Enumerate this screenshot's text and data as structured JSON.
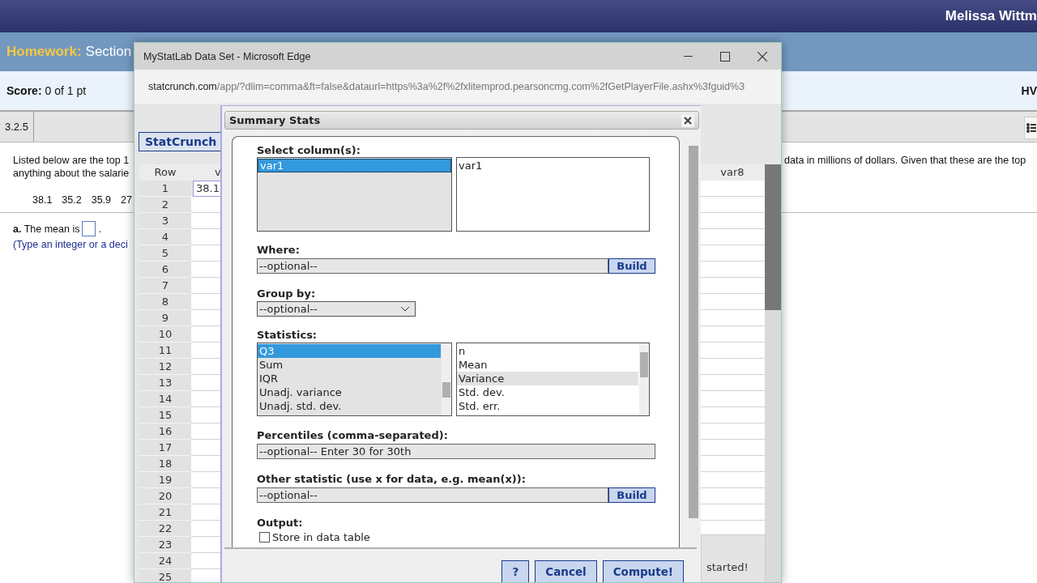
{
  "top_bar": {
    "user_name": "Melissa Wittm"
  },
  "header": {
    "label": "Homework:",
    "title": "Section"
  },
  "score_bar": {
    "score": "**Score:** 0 of 1 pt",
    "right_text": "HV"
  },
  "question_tab": {
    "label": "3.2.5"
  },
  "question": {
    "left_lines": [
      "Listed below are the top 1",
      "anything about the salarie"
    ],
    "right_line": "data in millions of dollars. Given that these are the top",
    "values": [
      "38.1",
      "35.2",
      "35.9",
      "27"
    ],
    "prompt": "**a.** The mean is",
    "prompt_end": ".",
    "hint": "(Type an integer or a deci"
  },
  "browser_window": {
    "title": "MyStatLab Data Set - Microsoft Edge",
    "url_host": "statcrunch.com",
    "url_path": "/app/?dlim=comma&ft=false&dataurl=https%3a%2f%2fxlitemprod.pearsoncmg.com%2fGetPlayerFile.ashx%3fguid%3"
  },
  "statcrunch": {
    "button": "StatCrunch",
    "row_header": "Row",
    "column_2_header": "v",
    "last_column_header": "var8",
    "popup_text": "started!",
    "rows": [
      {
        "number": "1",
        "value": "38.1"
      },
      {
        "number": "2"
      },
      {
        "number": "3"
      },
      {
        "number": "4"
      },
      {
        "number": "5"
      },
      {
        "number": "6"
      },
      {
        "number": "7"
      },
      {
        "number": "8"
      },
      {
        "number": "9"
      },
      {
        "number": "10"
      },
      {
        "number": "11"
      },
      {
        "number": "12"
      },
      {
        "number": "13"
      },
      {
        "number": "14"
      },
      {
        "number": "15"
      },
      {
        "number": "16"
      },
      {
        "number": "17"
      },
      {
        "number": "18"
      },
      {
        "number": "19"
      },
      {
        "number": "20"
      },
      {
        "number": "21"
      },
      {
        "number": "22"
      },
      {
        "number": "23"
      },
      {
        "number": "24"
      },
      {
        "number": "25"
      }
    ]
  },
  "dialog": {
    "title": "Summary Stats",
    "select_label": "Select column(s):",
    "columns_available": [
      {
        "label": "var1",
        "selected": true
      }
    ],
    "columns_chosen": [
      "var1"
    ],
    "where_label": "Where:",
    "where_placeholder": "--optional--",
    "where_build": "Build",
    "group_label": "Group by:",
    "group_value": "--optional--",
    "statistics_label": "Statistics:",
    "stats_available": [
      {
        "label": "Q3",
        "selected": true
      },
      {
        "label": "Sum",
        "selected": false
      },
      {
        "label": "IQR",
        "selected": false
      },
      {
        "label": "Unadj. variance",
        "selected": false
      },
      {
        "label": "Unadj. std. dev.",
        "selected": false
      }
    ],
    "stats_chosen": [
      {
        "label": "n",
        "hovered": false
      },
      {
        "label": "Mean",
        "hovered": false
      },
      {
        "label": "Variance",
        "hovered": true
      },
      {
        "label": "Std. dev.",
        "hovered": false
      },
      {
        "label": "Std. err.",
        "hovered": false
      }
    ],
    "percentiles_label": "Percentiles (comma-separated):",
    "percentiles_placeholder": "--optional-- Enter 30 for 30th",
    "other_label": "Other statistic (use x for data, e.g. mean(x)):",
    "other_placeholder": "--optional--",
    "other_build": "Build",
    "output_label": "Output:",
    "store": {
      "label": "Store in data table",
      "checked": false
    },
    "buttons": [
      "?",
      "Cancel",
      "Compute!"
    ]
  }
}
